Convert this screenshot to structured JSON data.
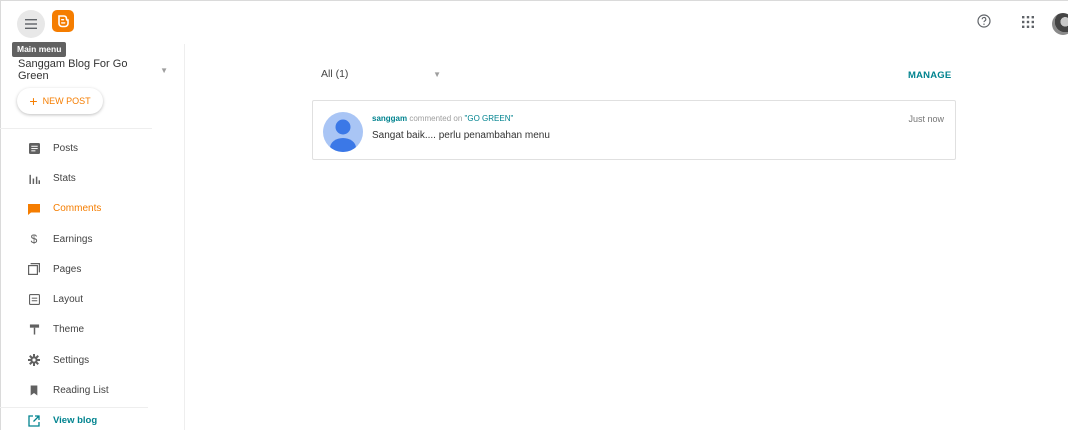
{
  "topbar": {
    "tooltip": "Main menu",
    "icons": {
      "menu": "hamburger-menu-icon",
      "logo": "blogger-logo",
      "help": "help-icon",
      "apps": "apps-grid-icon",
      "avatar": "user-avatar"
    }
  },
  "sidebar": {
    "blog_name": "Sanggam Blog For Go Green",
    "new_post_label": "NEW POST",
    "items": [
      {
        "label": "Posts",
        "icon": "posts-icon"
      },
      {
        "label": "Stats",
        "icon": "stats-icon"
      },
      {
        "label": "Comments",
        "icon": "comments-icon",
        "active": true
      },
      {
        "label": "Earnings",
        "icon": "dollar-icon"
      },
      {
        "label": "Pages",
        "icon": "pages-icon"
      },
      {
        "label": "Layout",
        "icon": "layout-icon"
      },
      {
        "label": "Theme",
        "icon": "paint-roller-icon"
      },
      {
        "label": "Settings",
        "icon": "gear-icon"
      },
      {
        "label": "Reading List",
        "icon": "bookmark-icon"
      },
      {
        "label": "View blog",
        "icon": "open-external-icon"
      }
    ]
  },
  "main": {
    "filter_value": "All (1)",
    "manage_label": "MANAGE",
    "comments": [
      {
        "author": "sanggam",
        "action": "commented on",
        "post_title": "\"GO GREEN\"",
        "text": "Sangat baik.... perlu penambahan menu",
        "time": "Just now"
      }
    ]
  },
  "colors": {
    "accent": "#f57d00",
    "link": "#00838f",
    "avatar_bg": "#a9c5f5",
    "avatar_fg": "#3b78e7"
  }
}
